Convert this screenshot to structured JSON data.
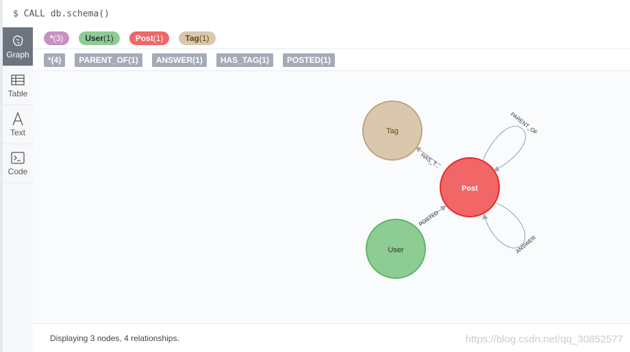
{
  "command": {
    "prompt": "$",
    "text": "CALL db.schema()"
  },
  "sidebar": {
    "items": [
      {
        "label": "Graph",
        "icon": "graph-icon",
        "active": true
      },
      {
        "label": "Table",
        "icon": "table-icon",
        "active": false
      },
      {
        "label": "Text",
        "icon": "text-icon",
        "active": false
      },
      {
        "label": "Code",
        "icon": "code-icon",
        "active": false
      }
    ]
  },
  "node_labels": [
    {
      "name": "*",
      "count": "(3)",
      "bg": "#c990c0",
      "fg": "#ffffff"
    },
    {
      "name": "User",
      "count": "(1)",
      "bg": "#8dcc93",
      "fg": "#2a2c34"
    },
    {
      "name": "Post",
      "count": "(1)",
      "bg": "#f16667",
      "fg": "#ffffff"
    },
    {
      "name": "Tag",
      "count": "(1)",
      "bg": "#d9c8ae",
      "fg": "#604a0e"
    }
  ],
  "relationship_types": [
    {
      "name": "*",
      "count": "(4)"
    },
    {
      "name": "PARENT_OF",
      "count": "(1)"
    },
    {
      "name": "ANSWER",
      "count": "(1)"
    },
    {
      "name": "HAS_TAG",
      "count": "(1)"
    },
    {
      "name": "POSTED",
      "count": "(1)"
    }
  ],
  "graph": {
    "nodes": {
      "tag": {
        "label": "Tag",
        "fill": "#d9c8ae",
        "stroke": "#c0a378",
        "text": "#604a0e"
      },
      "post": {
        "label": "Post",
        "fill": "#f16667",
        "stroke": "#eb2728",
        "text": "#ffffff"
      },
      "user": {
        "label": "User",
        "fill": "#8dcc93",
        "stroke": "#5db665",
        "text": "#2a2c34"
      }
    },
    "relationships": {
      "has_tag": "HAS_T...",
      "posted": "POSTED",
      "parent_of": "PARENT_OF",
      "answer": "ANSWER"
    },
    "edge_color": "#a5abb6"
  },
  "status": {
    "text": "Displaying 3 nodes, 4 relationships."
  },
  "watermark": "https://blog.csdn.net/qq_30852577"
}
